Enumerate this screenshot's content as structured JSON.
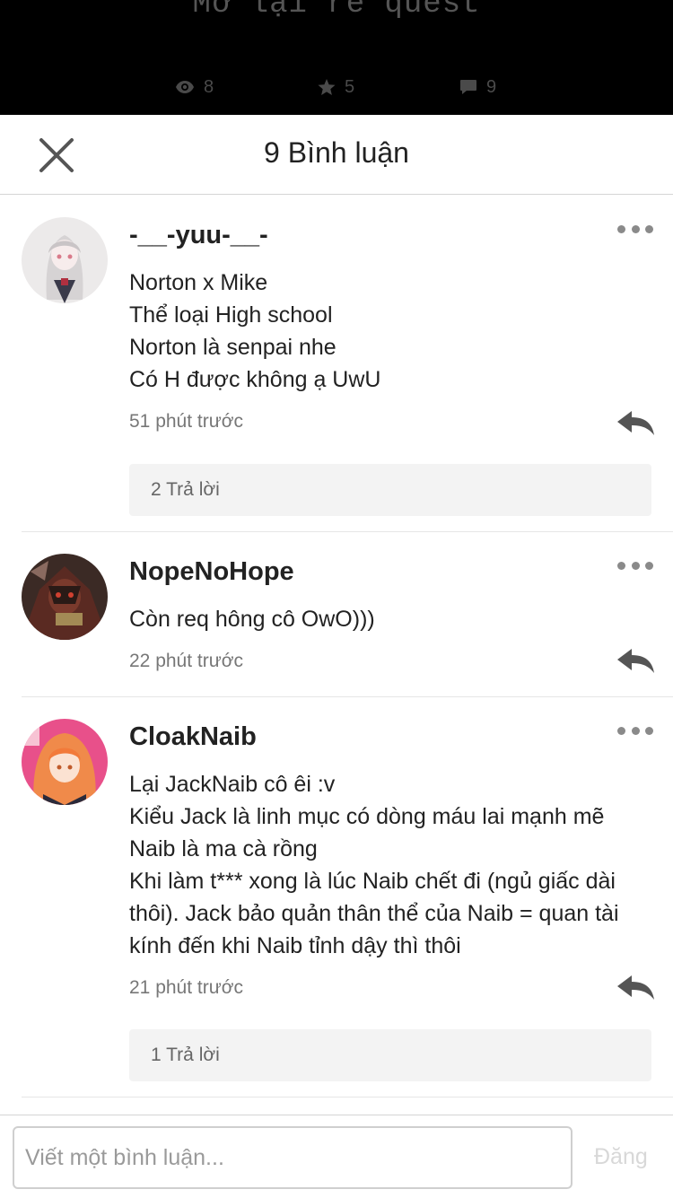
{
  "story": {
    "title": "Mở lại re quest",
    "views": "8",
    "votes": "5",
    "comments": "9"
  },
  "header": {
    "title": "9 Bình luận"
  },
  "comments": [
    {
      "username": "-__-yuu-__-",
      "body": "Norton x Mike\nThể loại High school\nNorton là senpai nhe\nCó H được không ạ UwU",
      "time": "51 phút trước",
      "replies": "2 Trả lời"
    },
    {
      "username": "NopeNoHope",
      "body": "Còn req hông cô OwO)))",
      "time": "22 phút trước"
    },
    {
      "username": "CloakNaib",
      "body": "Lại JackNaib cô êi :v\nKiểu Jack là linh mục có dòng máu lai mạnh mẽ\nNaib là ma cà rồng\nKhi làm t*** xong là lúc Naib chết đi (ngủ giấc dài thôi).  Jack bảo quản thân thể của Naib = quan tài kính đến khi Naib tỉnh dậy thì thôi",
      "time": "21 phút trước",
      "replies": "1 Trả lời"
    }
  ],
  "footer": {
    "placeholder": "Viết một bình luận...",
    "post_label": "Đăng"
  },
  "colors": {
    "top_bg": "#000000",
    "icon_gray": "#555555",
    "post_disabled": "#d8d8d8"
  }
}
